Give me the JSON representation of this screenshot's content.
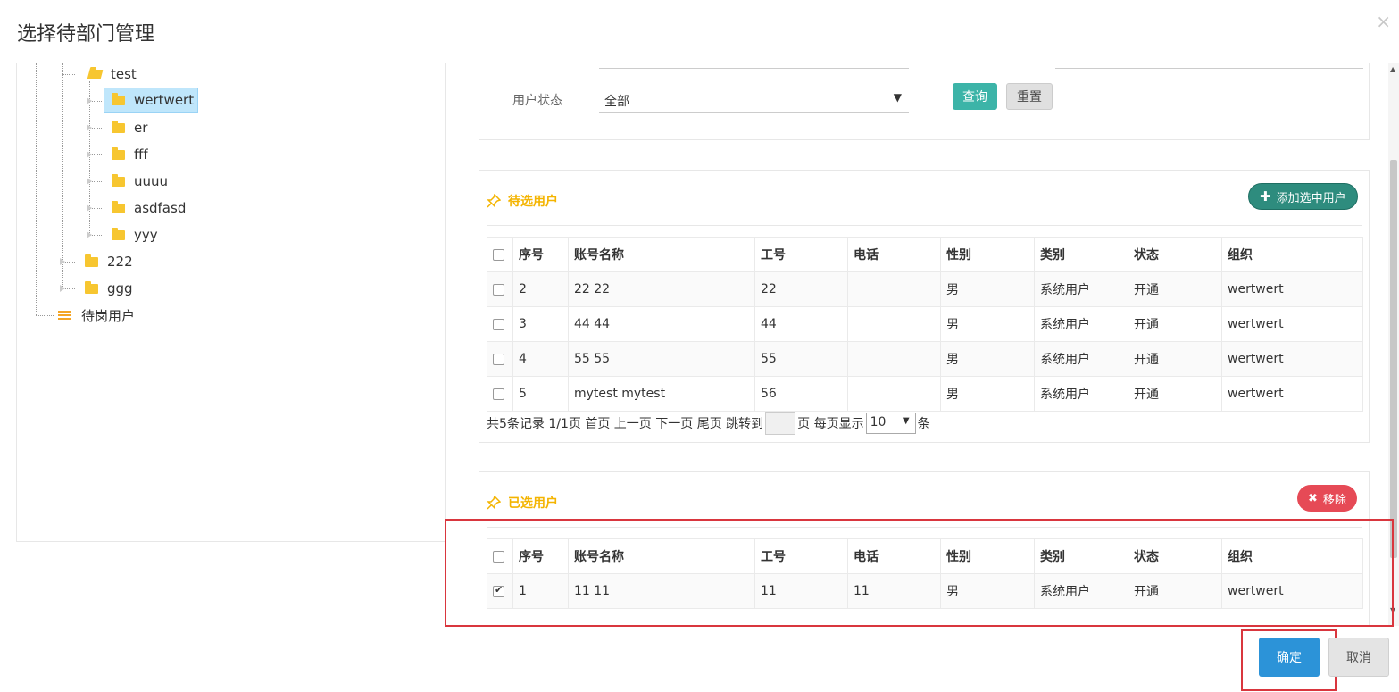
{
  "dialog": {
    "title": "选择待部门管理",
    "close_glyph": "×"
  },
  "tree": {
    "items": [
      {
        "label": "test"
      },
      {
        "label": "wertwert"
      },
      {
        "label": "er"
      },
      {
        "label": "fff"
      },
      {
        "label": "uuuu"
      },
      {
        "label": "asdfasd"
      },
      {
        "label": "yyy"
      },
      {
        "label": "222"
      },
      {
        "label": "ggg"
      },
      {
        "label": "待岗用户"
      }
    ]
  },
  "search": {
    "status_label": "用户状态",
    "status_value": "全部",
    "query_label": "查询",
    "reset_label": "重置"
  },
  "pending": {
    "title": "待选用户",
    "add_label": "添加选中用户",
    "columns": [
      "序号",
      "账号名称",
      "工号",
      "电话",
      "性别",
      "类别",
      "状态",
      "组织"
    ],
    "rows": [
      {
        "no": "2",
        "name": "22 22",
        "id": "22",
        "phone": "",
        "gender": "男",
        "type": "系统用户",
        "status": "开通",
        "org": "wertwert"
      },
      {
        "no": "3",
        "name": "44 44",
        "id": "44",
        "phone": "",
        "gender": "男",
        "type": "系统用户",
        "status": "开通",
        "org": "wertwert"
      },
      {
        "no": "4",
        "name": "55 55",
        "id": "55",
        "phone": "",
        "gender": "男",
        "type": "系统用户",
        "status": "开通",
        "org": "wertwert"
      },
      {
        "no": "5",
        "name": "mytest mytest",
        "id": "56",
        "phone": "",
        "gender": "男",
        "type": "系统用户",
        "status": "开通",
        "org": "wertwert"
      }
    ],
    "pager": {
      "summary": "共5条记录 1/1页",
      "first": "首页",
      "prev": "上一页",
      "next": "下一页",
      "last": "尾页",
      "jump_to": "跳转到",
      "page_unit": "页",
      "per_page": "每页显示",
      "per_page_value": "10",
      "per_page_unit": "条"
    }
  },
  "selected": {
    "title": "已选用户",
    "remove_label": "移除",
    "columns": [
      "序号",
      "账号名称",
      "工号",
      "电话",
      "性别",
      "类别",
      "状态",
      "组织"
    ],
    "rows": [
      {
        "no": "1",
        "name": "11 11",
        "id": "11",
        "phone": "11",
        "gender": "男",
        "type": "系统用户",
        "status": "开通",
        "org": "wertwert",
        "checked": true
      }
    ]
  },
  "footer": {
    "ok_label": "确定",
    "cancel_label": "取消"
  },
  "colors": {
    "accent": "#2c93d8",
    "teal": "#3cb4a8",
    "danger": "#e64a56",
    "section_title": "#f4b400",
    "highlight": "#d9363e"
  }
}
